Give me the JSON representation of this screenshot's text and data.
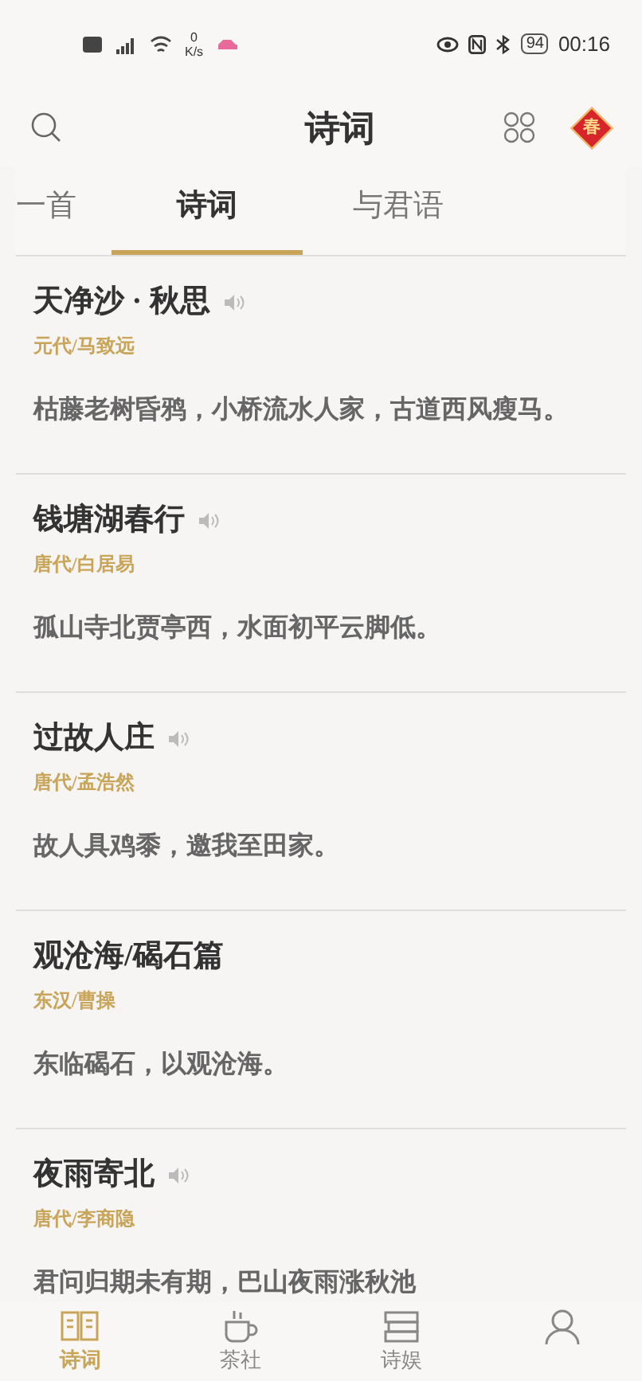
{
  "status_bar": {
    "speed_value": "0",
    "speed_unit": "K/s",
    "battery": "94",
    "time": "00:16"
  },
  "header": {
    "title": "诗词",
    "badge": "春"
  },
  "tabs": [
    {
      "label": "一首",
      "selected": false
    },
    {
      "label": "诗词",
      "selected": true
    },
    {
      "label": "与君语",
      "selected": false
    }
  ],
  "poems": [
    {
      "title": "天净沙 · 秋思",
      "audio": true,
      "meta": "元代/马致远",
      "verse": "枯藤老树昏鸦，小桥流水人家，古道西风瘦马。"
    },
    {
      "title": "钱塘湖春行",
      "audio": true,
      "meta": "唐代/白居易",
      "verse": "孤山寺北贾亭西，水面初平云脚低。"
    },
    {
      "title": "过故人庄",
      "audio": true,
      "meta": "唐代/孟浩然",
      "verse": "故人具鸡黍，邀我至田家。"
    },
    {
      "title": "观沧海/碣石篇",
      "audio": false,
      "meta": "东汉/曹操",
      "verse": "东临碣石，以观沧海。"
    },
    {
      "title": "夜雨寄北",
      "audio": true,
      "meta": "唐代/李商隐",
      "verse": "君问归期未有期，巴山夜雨涨秋池"
    }
  ],
  "bottom_nav": [
    {
      "kind": "book",
      "label": "诗词",
      "selected": true
    },
    {
      "kind": "cup",
      "label": "茶社",
      "selected": false
    },
    {
      "kind": "books",
      "label": "诗娱",
      "selected": false
    },
    {
      "kind": "person",
      "selected": false
    }
  ]
}
